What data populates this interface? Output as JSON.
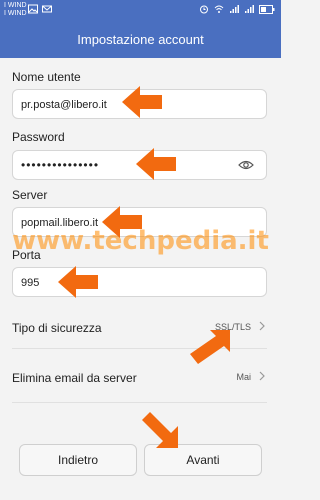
{
  "status_bar": {
    "carrier_1": "I WIND",
    "carrier_2": "I WIND"
  },
  "header": {
    "title": "Impostazione account"
  },
  "form": {
    "username_label": "Nome utente",
    "username_value": "pr.posta@libero.it",
    "password_label": "Password",
    "password_mask": "•••••••••••••••",
    "server_label": "Server",
    "server_value": "popmail.libero.it",
    "port_label": "Porta",
    "port_value": "995"
  },
  "settings": {
    "security_label": "Tipo di sicurezza",
    "security_value": "SSL/TLS",
    "delete_label": "Elimina email da server",
    "delete_value": "Mai"
  },
  "buttons": {
    "back": "Indietro",
    "next": "Avanti"
  },
  "watermark": "www.techpedia.it",
  "colors": {
    "header": "#4a6fc0",
    "annotation_arrow": "#f26a10",
    "watermark": "#ff8a00"
  },
  "icons": [
    "picture-icon",
    "mail-icon",
    "alarm-icon",
    "wifi-icon",
    "signal-icon",
    "battery-icon",
    "eye-icon",
    "chevron-right-icon",
    "arrow-annotation-icon"
  ]
}
